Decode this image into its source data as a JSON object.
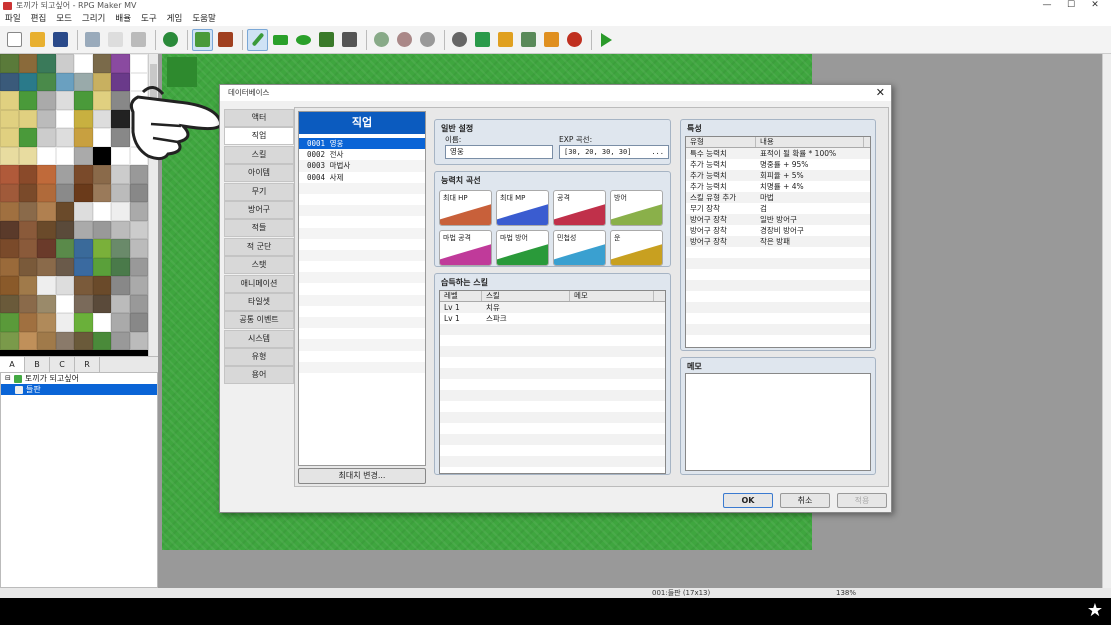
{
  "window": {
    "title": "토끼가 되고싶어 - RPG Maker MV",
    "minimize": "—",
    "maximize": "☐",
    "close": "✕"
  },
  "menu": [
    "파일",
    "편집",
    "모드",
    "그리기",
    "배율",
    "도구",
    "게임",
    "도움말"
  ],
  "toolbar": {
    "icons": [
      "new-icon",
      "open-icon",
      "save-icon",
      "cut-icon",
      "copy-icon",
      "paste-icon",
      "undo-icon",
      "map-mode-icon",
      "event-mode-icon",
      "pencil-icon",
      "rectangle-icon",
      "ellipse-icon",
      "fill-icon",
      "shadow-pen-icon",
      "zoom-in-icon",
      "zoom-out-icon",
      "zoom-actual-icon",
      "database-icon",
      "plugin-icon",
      "sound-icon",
      "event-search-icon",
      "resource-manager-icon",
      "character-generator-icon",
      "playtest-icon"
    ]
  },
  "tileset_tabs": [
    "A",
    "B",
    "C",
    "R"
  ],
  "map_tree": {
    "project": "토끼가 되고싶어",
    "map": "들판"
  },
  "statusbar": {
    "map": "001:들판 (17x13)",
    "zoom": "138%"
  },
  "dialog": {
    "title": "데이터베이스",
    "categories": [
      "액터",
      "직업",
      "스킬",
      "아이템",
      "무기",
      "방어구",
      "적들",
      "적 군단",
      "스탯",
      "애니메이션",
      "타일셋",
      "공통 이벤트",
      "시스템",
      "유형",
      "용어"
    ],
    "selected_category": "직업",
    "list_title": "직업",
    "list": [
      "0001 영웅",
      "0002 전사",
      "0003 마법사",
      "0004 사제"
    ],
    "max_button": "최대치 변경...",
    "general": {
      "title": "일반 설정",
      "name_label": "이름:",
      "name": "영웅",
      "exp_label": "EXP 곡선:",
      "exp": "[30, 20, 30, 30]",
      "exp_btn": "..."
    },
    "params": {
      "title": "능력치 곡선",
      "items": [
        {
          "label": "최대 HP",
          "color": "#c8603a"
        },
        {
          "label": "최대 MP",
          "color": "#3a5cd0"
        },
        {
          "label": "공격",
          "color": "#c0304a"
        },
        {
          "label": "방어",
          "color": "#8ab04a"
        },
        {
          "label": "마법 공격",
          "color": "#c03a9a"
        },
        {
          "label": "마법 방어",
          "color": "#2a9a3a"
        },
        {
          "label": "민첩성",
          "color": "#3aa0d0"
        },
        {
          "label": "운",
          "color": "#c8a020"
        }
      ]
    },
    "skills": {
      "title": "습득하는 스킬",
      "headers": [
        "레벨",
        "스킬",
        "메모"
      ],
      "rows": [
        [
          "Lv  1",
          "치유",
          ""
        ],
        [
          "Lv  1",
          "스파크",
          ""
        ]
      ]
    },
    "traits": {
      "title": "특성",
      "headers": [
        "유형",
        "내용"
      ],
      "rows": [
        [
          "특수 능력치",
          "표적이 될 확률 * 100%"
        ],
        [
          "추가 능력치",
          "명중률 + 95%"
        ],
        [
          "추가 능력치",
          "회피율 + 5%"
        ],
        [
          "추가 능력치",
          "치명률 + 4%"
        ],
        [
          "스킬 유형 추가",
          "마법"
        ],
        [
          "무기 장착",
          "검"
        ],
        [
          "방어구 장착",
          "일반 방어구"
        ],
        [
          "방어구 장착",
          "경장비 방어구"
        ],
        [
          "방어구 장착",
          "작은 방패"
        ]
      ]
    },
    "note": {
      "title": "메모"
    },
    "buttons": {
      "ok": "OK",
      "cancel": "취소",
      "apply": "적용"
    }
  }
}
